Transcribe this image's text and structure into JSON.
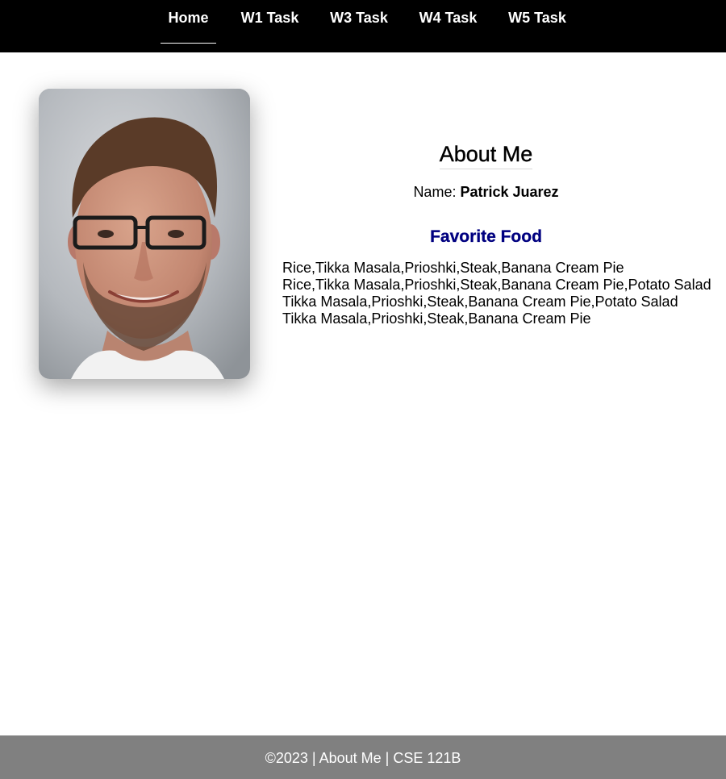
{
  "nav": {
    "items": [
      {
        "label": "Home",
        "active": true
      },
      {
        "label": "W1 Task",
        "active": false
      },
      {
        "label": "W3 Task",
        "active": false
      },
      {
        "label": "W4 Task",
        "active": false
      },
      {
        "label": "W5 Task",
        "active": false
      }
    ]
  },
  "about": {
    "title": "About Me",
    "name_label": "Name:",
    "name_value": "Patrick Juarez",
    "favorite_food_title": "Favorite Food",
    "food_lines": [
      "Rice,Tikka Masala,Prioshki,Steak,Banana Cream Pie",
      "Rice,Tikka Masala,Prioshki,Steak,Banana Cream Pie,Potato Salad",
      "Tikka Masala,Prioshki,Steak,Banana Cream Pie,Potato Salad",
      "Tikka Masala,Prioshki,Steak,Banana Cream Pie"
    ]
  },
  "footer": {
    "text": "©2023 | About Me | CSE 121B"
  },
  "colors": {
    "nav_background": "#000000",
    "footer_background": "#808080",
    "favorite_food_title": "#000080"
  }
}
